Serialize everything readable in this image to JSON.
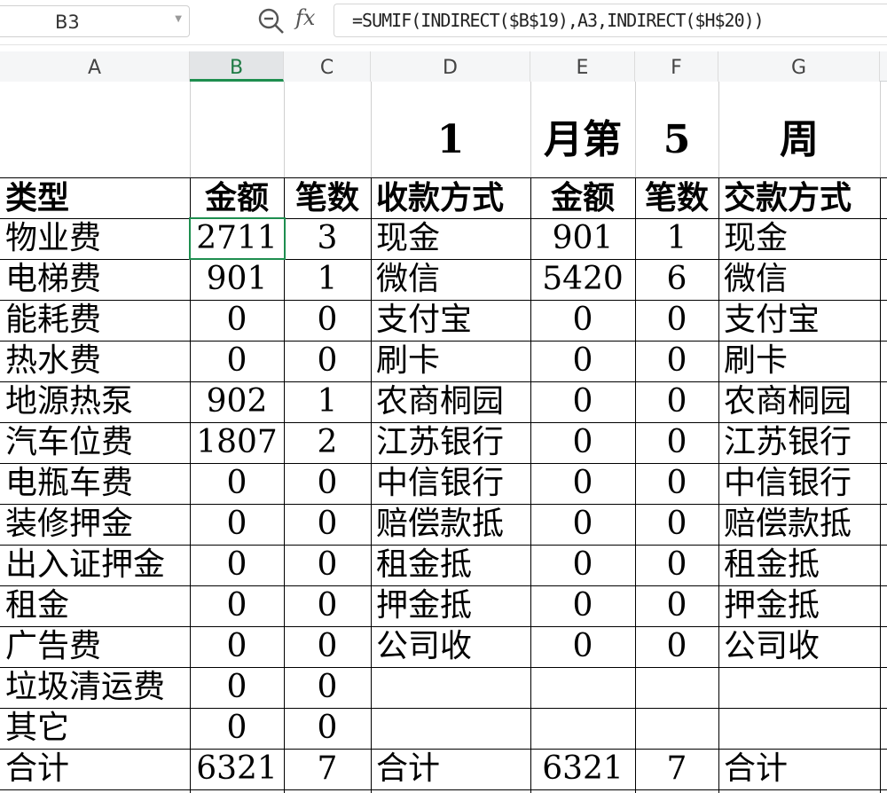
{
  "formula_bar": {
    "cell_ref": "B3",
    "formula": "=SUMIF(INDIRECT($B$19),A3,INDIRECT($H$20))",
    "fx_label": "fx"
  },
  "columns": [
    "A",
    "B",
    "C",
    "D",
    "E",
    "F",
    "G"
  ],
  "selected_column": "B",
  "title_row": {
    "d": "1",
    "e": "月第",
    "f": "5",
    "g": "周"
  },
  "headers": {
    "a": "类型",
    "b": "金额",
    "c": "笔数",
    "d": "收款方式",
    "e": "金额",
    "f": "笔数",
    "g": "交款方式"
  },
  "rows": [
    {
      "a": "物业费",
      "b": "2711",
      "c": "3",
      "d": "现金",
      "e": "901",
      "f": "1",
      "g": "现金"
    },
    {
      "a": "电梯费",
      "b": "901",
      "c": "1",
      "d": "微信",
      "e": "5420",
      "f": "6",
      "g": "微信"
    },
    {
      "a": "能耗费",
      "b": "0",
      "c": "0",
      "d": "支付宝",
      "e": "0",
      "f": "0",
      "g": "支付宝"
    },
    {
      "a": "热水费",
      "b": "0",
      "c": "0",
      "d": "刷卡",
      "e": "0",
      "f": "0",
      "g": "刷卡"
    },
    {
      "a": "地源热泵",
      "b": "902",
      "c": "1",
      "d": "农商桐园",
      "e": "0",
      "f": "0",
      "g": "农商桐园"
    },
    {
      "a": "汽车位费",
      "b": "1807",
      "c": "2",
      "d": "江苏银行",
      "e": "0",
      "f": "0",
      "g": "江苏银行"
    },
    {
      "a": "电瓶车费",
      "b": "0",
      "c": "0",
      "d": "中信银行",
      "e": "0",
      "f": "0",
      "g": "中信银行"
    },
    {
      "a": "装修押金",
      "b": "0",
      "c": "0",
      "d": "赔偿款抵",
      "e": "0",
      "f": "0",
      "g": "赔偿款抵"
    },
    {
      "a": "出入证押金",
      "b": "0",
      "c": "0",
      "d": "租金抵",
      "e": "0",
      "f": "0",
      "g": "租金抵"
    },
    {
      "a": "租金",
      "b": "0",
      "c": "0",
      "d": "押金抵",
      "e": "0",
      "f": "0",
      "g": "押金抵"
    },
    {
      "a": "广告费",
      "b": "0",
      "c": "0",
      "d": "公司收",
      "e": "0",
      "f": "0",
      "g": "公司收"
    },
    {
      "a": "垃圾清运费",
      "b": "0",
      "c": "0",
      "d": "",
      "e": "",
      "f": "",
      "g": ""
    },
    {
      "a": "其它",
      "b": "0",
      "c": "0",
      "d": "",
      "e": "",
      "f": "",
      "g": ""
    },
    {
      "a": "合计",
      "b": "6321",
      "c": "7",
      "d": "合计",
      "e": "6321",
      "f": "7",
      "g": "合计"
    }
  ]
}
